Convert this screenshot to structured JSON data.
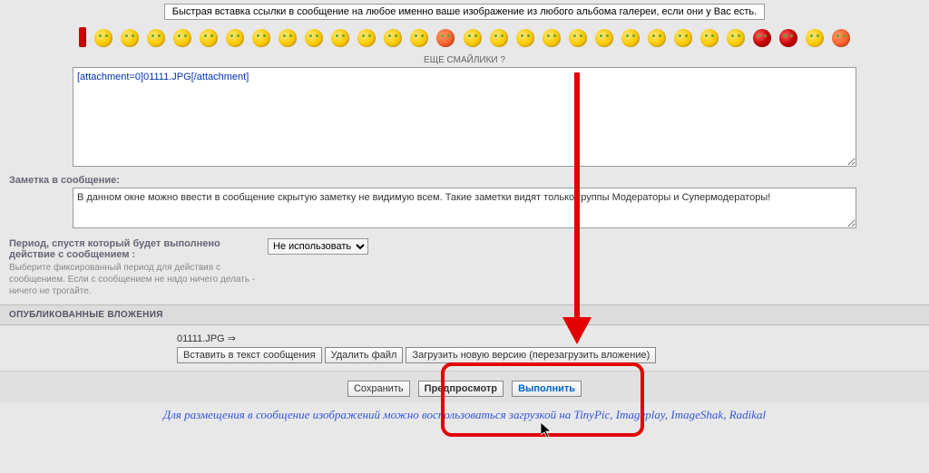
{
  "top_link_text": "Быстрая вставка ссылки в сообщение на любое именно ваше изображение из любого альбома галереи, если они у Вас есть.",
  "more_smileys": "ЕЩЕ СМАЙЛИКИ ?",
  "message_value": "[attachment=0]01111.JPG[/attachment]",
  "note_label": "Заметка в сообщение:",
  "note_value": "В данном окне можно ввести в сообщение скрытую заметку не видимую всем. Такие заметки видят только группы Модераторы и Супермодераторы!",
  "period": {
    "title": "Период, спустя который будет выполнено действие с сообщением :",
    "desc": "Выберите фиксированный период для действия с сообщением. Если с сообщением не надо ничего делать - ничего не трогайте.",
    "selected": "Не использовать"
  },
  "attachments": {
    "header": "ОПУБЛИКОВАННЫЕ ВЛОЖЕНИЯ",
    "filename": "01111.JPG ⇒",
    "btn_insert": "Вставить в текст сообщения",
    "btn_delete": "Удалить файл",
    "btn_reload": "Загрузить новую версию (перезагрузить вложение)"
  },
  "submit": {
    "save": "Сохранить",
    "preview": "Предпросмотр",
    "execute": "Выполнить"
  },
  "footer": "Для размещения в сообщение изображений можно воспользоваться загрузкой на TinyPic, Imageplay, ImageShak, Radikal"
}
